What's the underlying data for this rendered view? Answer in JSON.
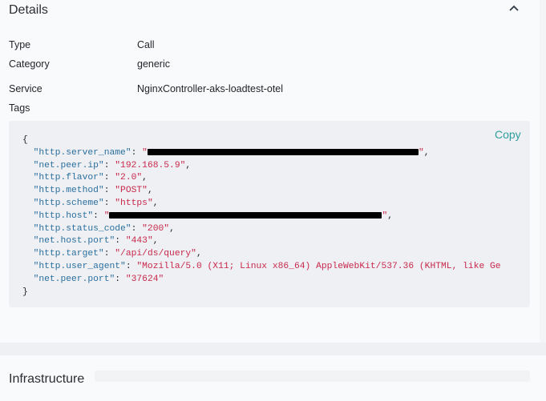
{
  "details": {
    "title": "Details",
    "collapse_icon": "chevron-up-icon",
    "fields": [
      {
        "label": "Type",
        "value": "Call"
      },
      {
        "label": "Category",
        "value": "generic"
      },
      {
        "label": "Service",
        "value": "NginxController-aks-loadtest-otel"
      }
    ],
    "tags_label": "Tags",
    "copy_label": "Copy"
  },
  "tags": {
    "open": "{",
    "close": "}",
    "entries": [
      {
        "key": "\"http.server_name\"",
        "value": "",
        "redacted": true
      },
      {
        "key": "\"net.peer.ip\"",
        "value": "\"192.168.5.9\""
      },
      {
        "key": "\"http.flavor\"",
        "value": "\"2.0\""
      },
      {
        "key": "\"http.method\"",
        "value": "\"POST\""
      },
      {
        "key": "\"http.scheme\"",
        "value": "\"https\""
      },
      {
        "key": "\"http.host\"",
        "value": "",
        "redacted": true
      },
      {
        "key": "\"http.status_code\"",
        "value": "\"200\""
      },
      {
        "key": "\"net.host.port\"",
        "value": "\"443\""
      },
      {
        "key": "\"http.target\"",
        "value": "\"/api/ds/query\""
      },
      {
        "key": "\"http.user_agent\"",
        "value": "\"Mozilla/5.0 (X11; Linux x86_64) AppleWebKit/537.36 (KHTML, like Ge"
      },
      {
        "key": "\"net.peer.port\"",
        "value": "\"37624\""
      }
    ]
  },
  "infrastructure": {
    "title": "Infrastructure"
  },
  "colors": {
    "accent": "#2f9e9e",
    "key": "#2b6f9e",
    "string": "#c8284c"
  }
}
